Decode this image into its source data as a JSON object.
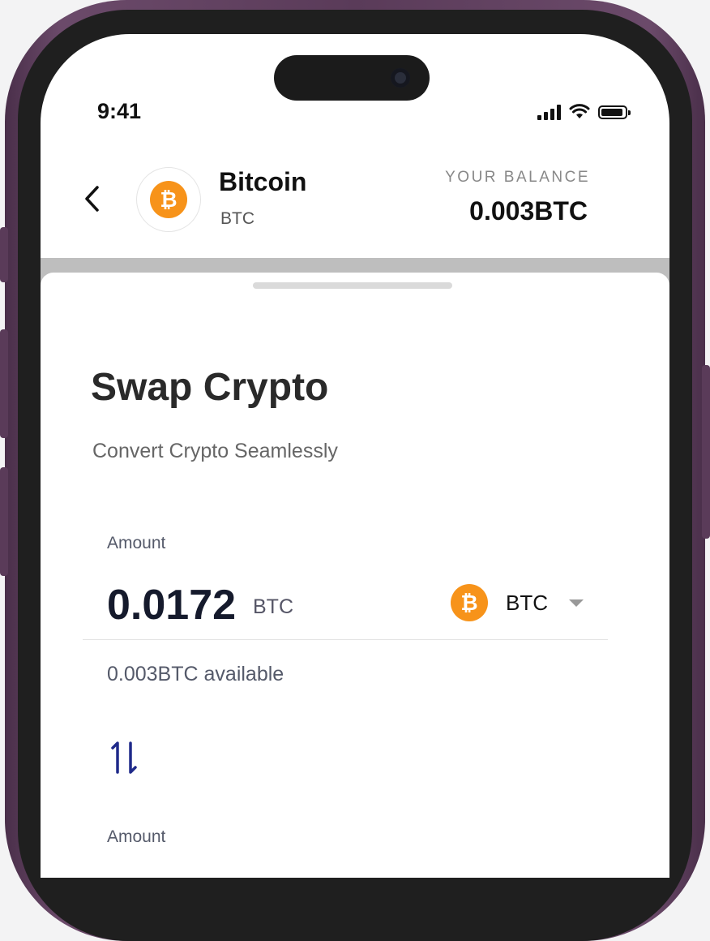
{
  "status_bar": {
    "time": "9:41"
  },
  "header": {
    "coin_name": "Bitcoin",
    "coin_symbol": "BTC",
    "coin_glyph": "₿",
    "balance_label": "YOUR BALANCE",
    "balance_value": "0.003BTC"
  },
  "swap": {
    "title": "Swap Crypto",
    "subtitle": "Convert Crypto Seamlessly",
    "from": {
      "label": "Amount",
      "value": "0.0172",
      "unit": "BTC",
      "token": "BTC",
      "available": "0.003BTC available"
    },
    "to": {
      "label": "Amount"
    }
  },
  "colors": {
    "bitcoin_orange": "#f7931a",
    "swap_icon": "#1f2a8a",
    "phone_frame": "#5a3b59"
  },
  "icons": [
    "back-icon",
    "bitcoin-icon",
    "signal-icon",
    "wifi-icon",
    "battery-icon",
    "chevron-down-icon",
    "swap-arrows-icon"
  ]
}
